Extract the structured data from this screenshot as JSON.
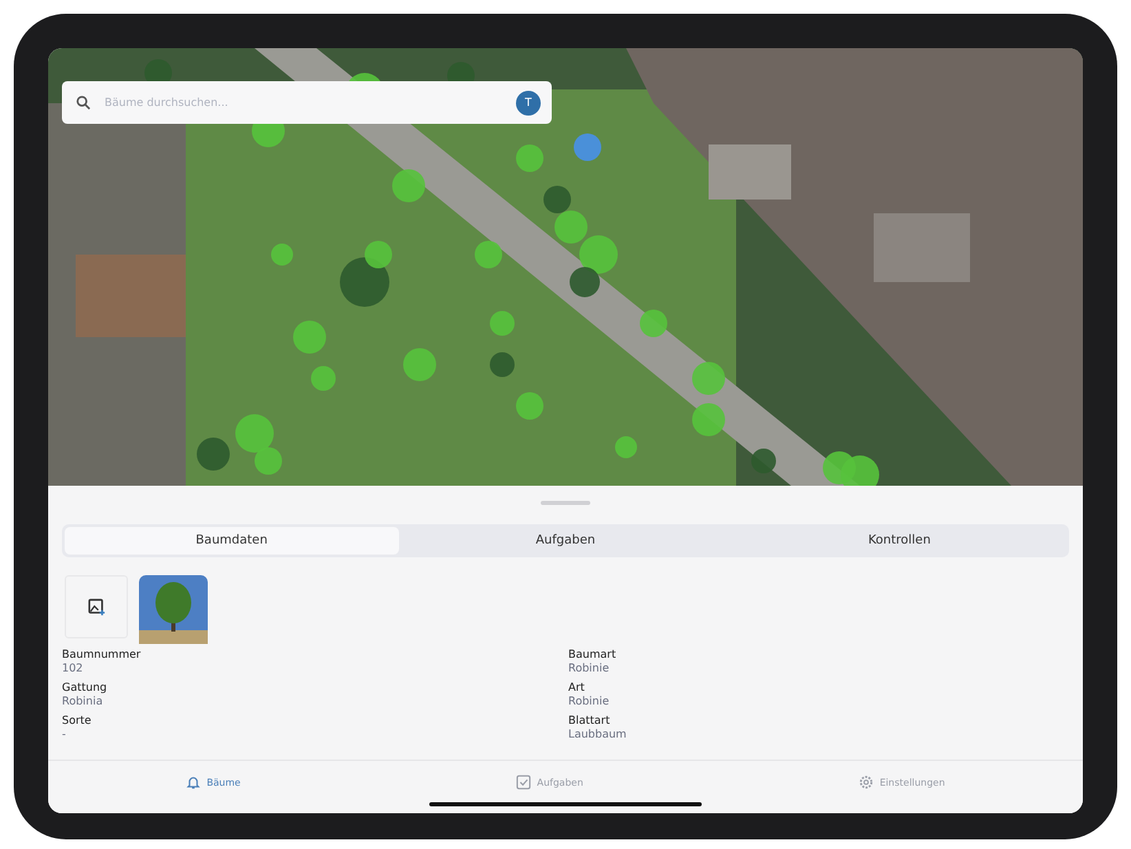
{
  "search": {
    "placeholder": "Bäume durchsuchen...",
    "avatar": "T"
  },
  "tabs": [
    {
      "label": "Baumdaten",
      "selected": true
    },
    {
      "label": "Aufgaben",
      "selected": false
    },
    {
      "label": "Kontrollen",
      "selected": false
    }
  ],
  "fields": [
    {
      "label": "Baumnummer",
      "value": "102"
    },
    {
      "label": "Baumart",
      "value": "Robinie"
    },
    {
      "label": "Gattung",
      "value": "Robinia"
    },
    {
      "label": "Art",
      "value": "Robinie"
    },
    {
      "label": "Sorte",
      "value": "-"
    },
    {
      "label": "Blattart",
      "value": "Laubbaum"
    }
  ],
  "tab_bar": [
    {
      "label": "Bäume",
      "kind": "bell",
      "selected": true,
      "disabled": false
    },
    {
      "label": "Aufgaben",
      "kind": "check",
      "selected": false,
      "disabled": true
    },
    {
      "label": "Einstellungen",
      "kind": "gear",
      "selected": false,
      "disabled": true
    }
  ]
}
